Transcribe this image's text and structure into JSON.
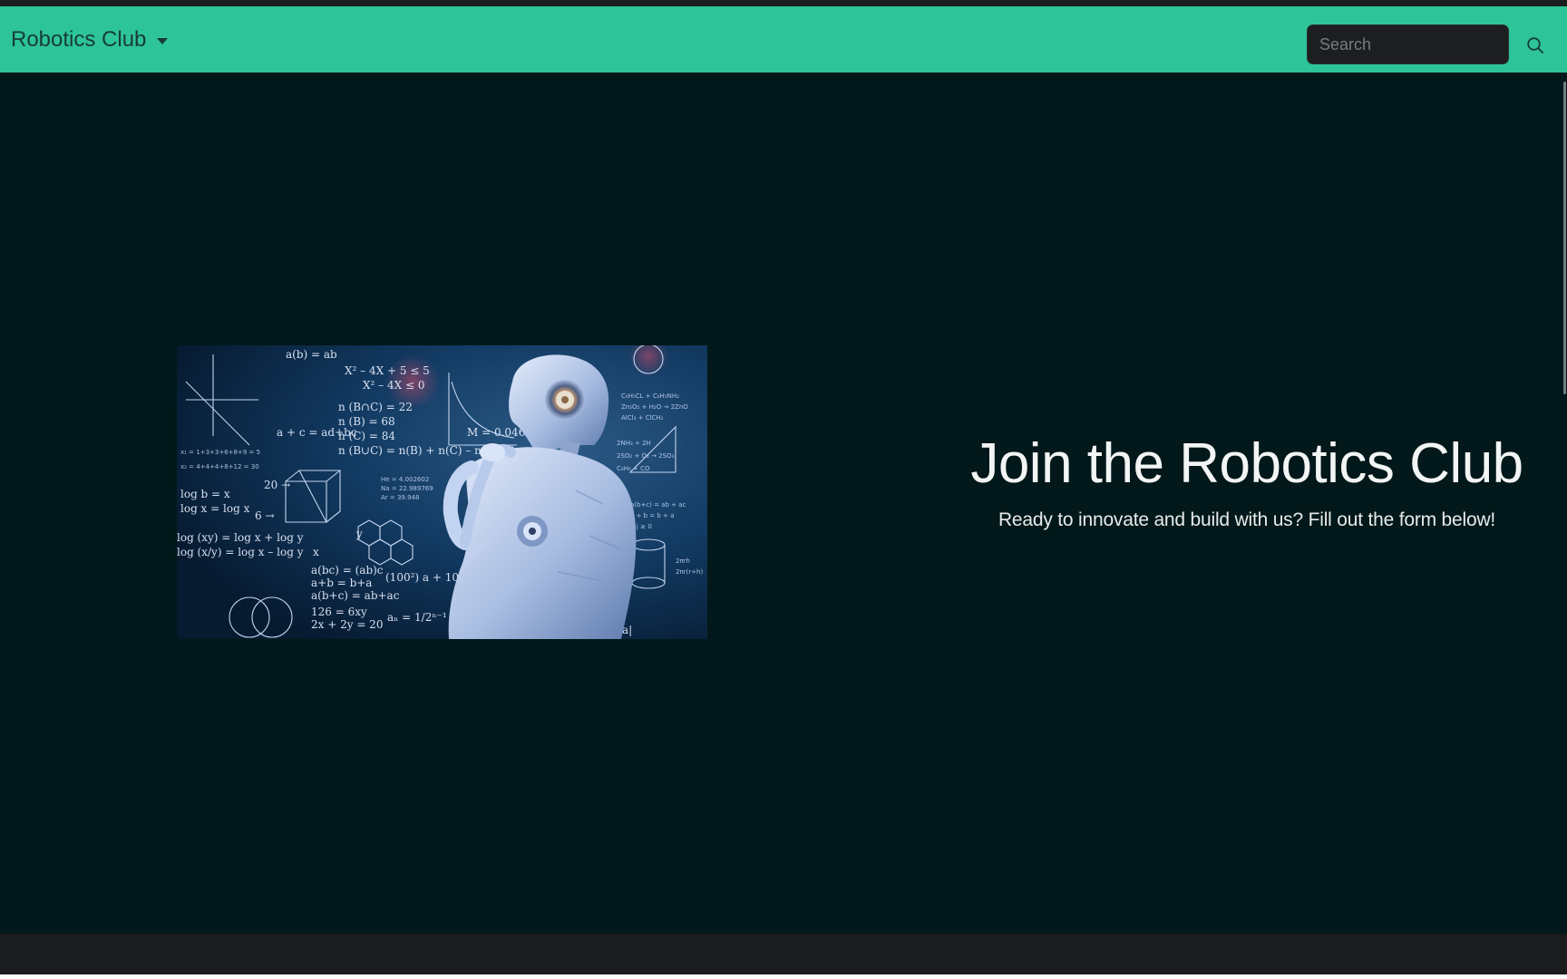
{
  "navbar": {
    "brand_label": "Robotics Club",
    "search_placeholder": "Search"
  },
  "hero": {
    "title": "Join the Robotics Club",
    "subtitle": "Ready to innovate and build with us? Fill out the form below!"
  },
  "colors": {
    "navbar_bg": "#2dc499",
    "page_bg": "#02181a",
    "search_bg": "#1c1e20",
    "footer_bg": "#1a1c1e"
  },
  "icons": {
    "dropdown": "caret-down-icon",
    "search": "search-icon"
  }
}
